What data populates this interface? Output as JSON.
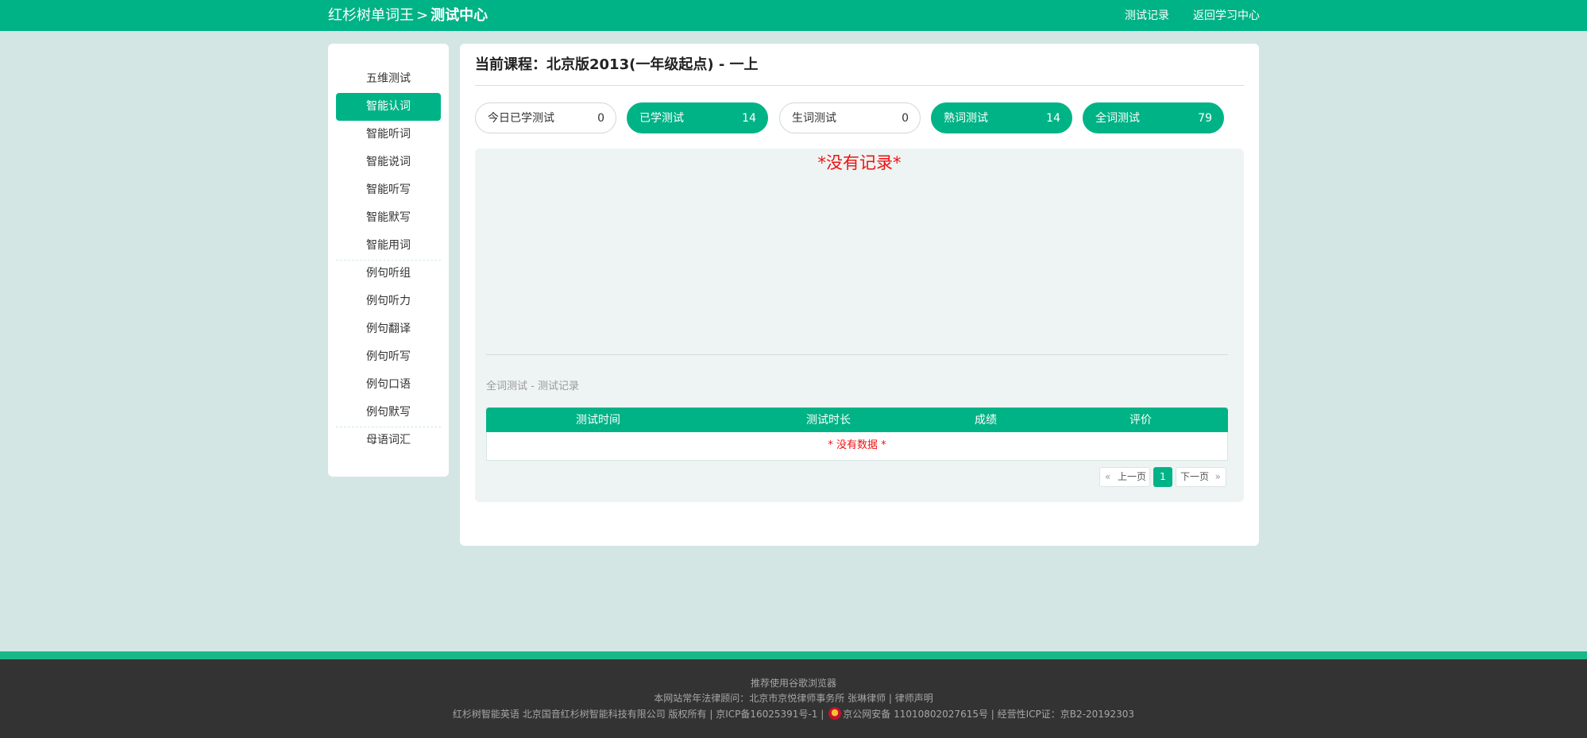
{
  "header": {
    "brand": "红杉树单词王",
    "separator": ">",
    "section": "测试中心",
    "links": {
      "records": "测试记录",
      "back": "返回学习中心"
    }
  },
  "sidebar": {
    "items": [
      {
        "label": "五维测试"
      },
      {
        "label": "智能认词",
        "active": true
      },
      {
        "label": "智能听词"
      },
      {
        "label": "智能说词"
      },
      {
        "label": "智能听写"
      },
      {
        "label": "智能默写"
      },
      {
        "label": "智能用词"
      },
      {
        "label": "例句听组"
      },
      {
        "label": "例句听力"
      },
      {
        "label": "例句翻译"
      },
      {
        "label": "例句听写"
      },
      {
        "label": "例句口语"
      },
      {
        "label": "例句默写"
      },
      {
        "label": "母语词汇"
      }
    ]
  },
  "main": {
    "course_title": "当前课程：北京版2013(一年级起点) - 一上",
    "filters": [
      {
        "label": "今日已学测试",
        "count": "0",
        "style": "outline"
      },
      {
        "label": "已学测试",
        "count": "14",
        "style": "green"
      },
      {
        "label": "生词测试",
        "count": "0",
        "style": "outline"
      },
      {
        "label": "熟词测试",
        "count": "14",
        "style": "green"
      },
      {
        "label": "全词测试",
        "count": "79",
        "style": "green"
      }
    ],
    "no_record": "*没有记录*",
    "records_title": "全词测试 - 测试记录",
    "table": {
      "headers": [
        "测试时间",
        "测试时长",
        "成绩",
        "评价"
      ],
      "empty_text": "* 没有数据 *"
    },
    "pagination": {
      "prev": "上一页",
      "current": "1",
      "next": "下一页"
    }
  },
  "footer": {
    "line1": "推荐使用谷歌浏览器",
    "line2": "本网站常年法律顾问：北京市京悦律师事务所 张琳律师 | 律师声明",
    "line3_a": "红杉树智能英语 北京国音红杉树智能科技有限公司 版权所有 | 京ICP备16025391号-1 |",
    "line3_b": "京公网安备 11010802027615号  | 经营性ICP证：京B2-20192303"
  },
  "colors": {
    "brand_green": "#00b386",
    "page_bg": "#d3e6e4",
    "footer_bg": "#333333",
    "alert_red": "#ee1111"
  },
  "icons": [
    "police-badge-icon",
    "double-chevron-left-icon",
    "double-chevron-right-icon"
  ]
}
